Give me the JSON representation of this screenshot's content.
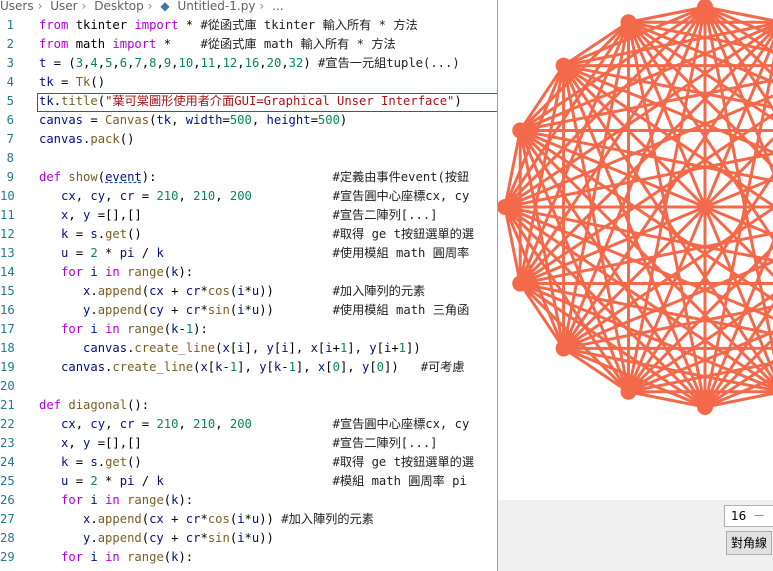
{
  "breadcrumb": [
    "Users",
    "User",
    "Desktop",
    "Untitled-1.py",
    "..."
  ],
  "code_lines": [
    {
      "n": "1",
      "t": "from tkinter import * #從函式庫 tkinter 輸入所有 * 方法"
    },
    {
      "n": "2",
      "t": "from math import *    #從函式庫 math 輸入所有 * 方法"
    },
    {
      "n": "3",
      "t": "t = (3,4,5,6,7,8,9,10,11,12,16,20,32) #宣告一元組tuple(...)"
    },
    {
      "n": "4",
      "t": "tk = Tk()"
    },
    {
      "n": "5",
      "t": "tk.title(\"葉可棠圖形使用者介面GUI=Graphical Unser Interface\")"
    },
    {
      "n": "6",
      "t": "canvas = Canvas(tk, width=500, height=500)"
    },
    {
      "n": "7",
      "t": "canvas.pack()"
    },
    {
      "n": "8",
      "t": ""
    },
    {
      "n": "9",
      "t": "def show(event):                        #定義由事件event(按鈕"
    },
    {
      "n": "10",
      "t": "   cx, cy, cr = 210, 210, 200           #宣告圓中心座標cx, cy"
    },
    {
      "n": "11",
      "t": "   x, y =[],[]                          #宣告二陣列[...]"
    },
    {
      "n": "12",
      "t": "   k = s.get()                          #取得 ge t按鈕選單的選"
    },
    {
      "n": "13",
      "t": "   u = 2 * pi / k                       #使用模組 math 圓周率"
    },
    {
      "n": "14",
      "t": "   for i in range(k):"
    },
    {
      "n": "15",
      "t": "      x.append(cx + cr*cos(i*u))        #加入陣列的元素"
    },
    {
      "n": "16",
      "t": "      y.append(cy + cr*sin(i*u))        #使用模組 math 三角函"
    },
    {
      "n": "17",
      "t": "   for i in range(k-1):"
    },
    {
      "n": "18",
      "t": "      canvas.create_line(x[i], y[i], x[i+1], y[i+1])"
    },
    {
      "n": "19",
      "t": "   canvas.create_line(x[k-1], y[k-1], x[0], y[0])   #可考慮"
    },
    {
      "n": "20",
      "t": ""
    },
    {
      "n": "21",
      "t": "def diagonal():"
    },
    {
      "n": "22",
      "t": "   cx, cy, cr = 210, 210, 200           #宣告圓中心座標cx, cy"
    },
    {
      "n": "23",
      "t": "   x, y =[],[]                          #宣告二陣列[...]"
    },
    {
      "n": "24",
      "t": "   k = s.get()                          #取得 ge t按鈕選單的選"
    },
    {
      "n": "25",
      "t": "   u = 2 * pi / k                       #模組 math 圓周率 pi"
    },
    {
      "n": "26",
      "t": "   for i in range(k):"
    },
    {
      "n": "27",
      "t": "      x.append(cx + cr*cos(i*u)) #加入陣列的元素"
    },
    {
      "n": "28",
      "t": "      y.append(cy + cr*sin(i*u))"
    },
    {
      "n": "29",
      "t": "   for i in range(k):"
    }
  ],
  "tk_window": {
    "k": 16,
    "spinbox_value": "16",
    "button_label": "對角線",
    "line_color": "#f4694a",
    "polygon_outline_color": "#000000"
  }
}
